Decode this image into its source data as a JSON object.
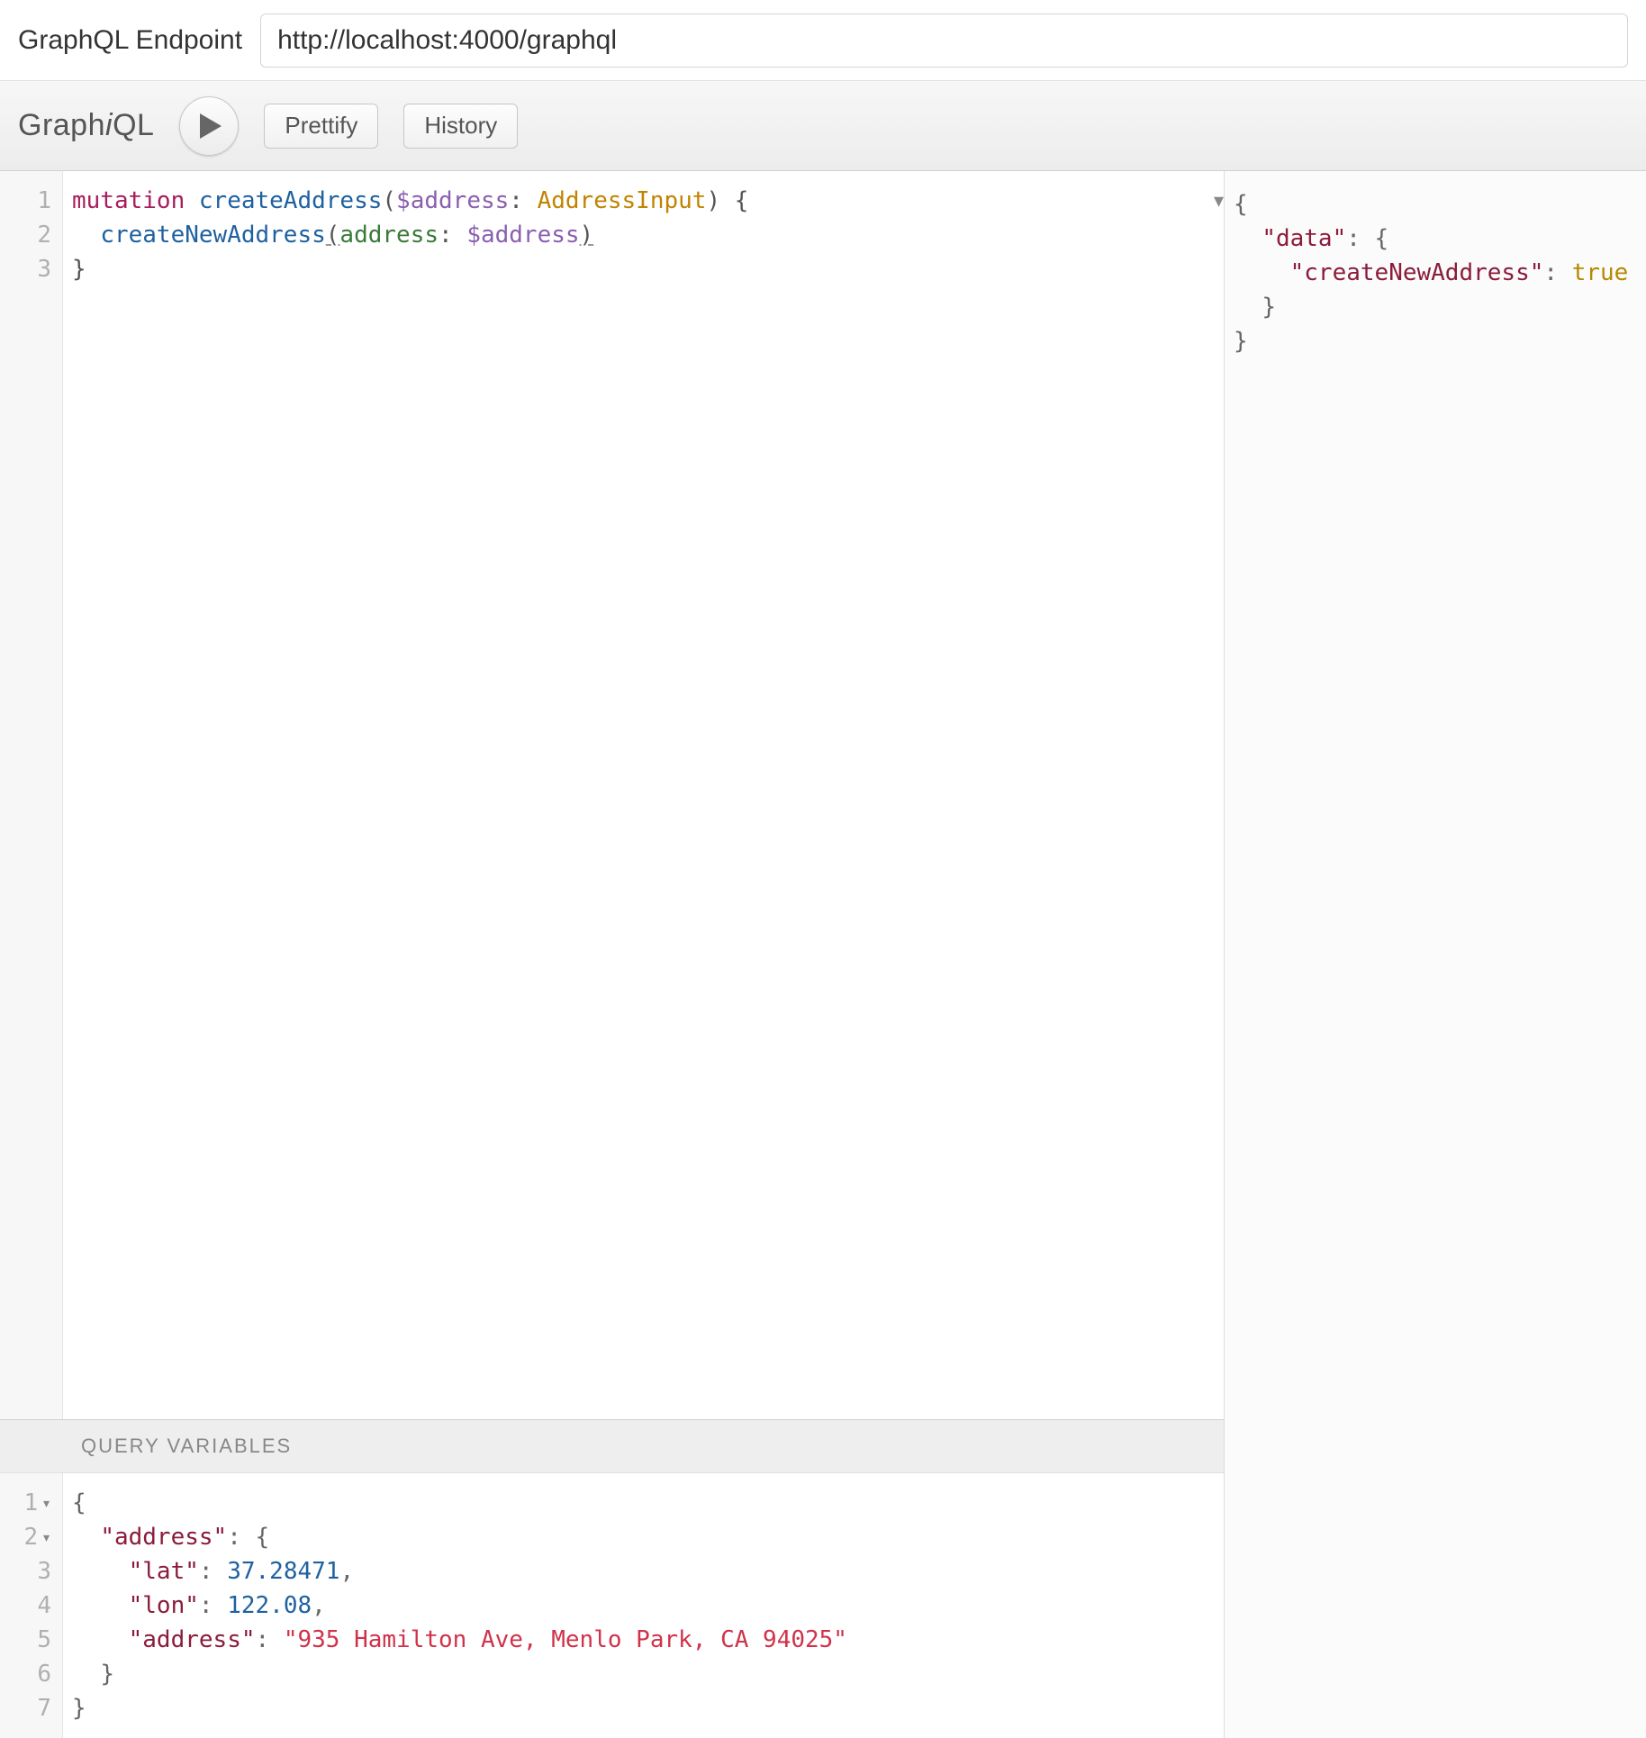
{
  "endpoint": {
    "label": "GraphQL Endpoint",
    "value": "http://localhost:4000/graphql"
  },
  "toolbar": {
    "logo_prefix": "Graph",
    "logo_i": "i",
    "logo_suffix": "QL",
    "prettify_label": "Prettify",
    "history_label": "History"
  },
  "query_editor": {
    "line_numbers": [
      "1",
      "2",
      "3"
    ],
    "tokens": {
      "l1_kw": "mutation",
      "l1_name": "createAddress",
      "l1_var": "$address",
      "l1_type": "AddressInput",
      "l2_field": "createNewAddress",
      "l2_arg": "address",
      "l2_var": "$address"
    }
  },
  "variables": {
    "header": "QUERY VARIABLES",
    "line_numbers": [
      "1",
      "2",
      "3",
      "4",
      "5",
      "6",
      "7"
    ],
    "fold_lines": [
      1,
      2
    ],
    "tokens": {
      "k_address": "\"address\"",
      "k_lat": "\"lat\"",
      "v_lat": "37.28471",
      "k_lon": "\"lon\"",
      "v_lon": "122.08",
      "k_address2": "\"address\"",
      "v_address2": "\"935 Hamilton Ave, Menlo Park, CA 94025\""
    }
  },
  "result": {
    "tokens": {
      "k_data": "\"data\"",
      "k_createNewAddress": "\"createNewAddress\"",
      "v_true": "true"
    }
  }
}
